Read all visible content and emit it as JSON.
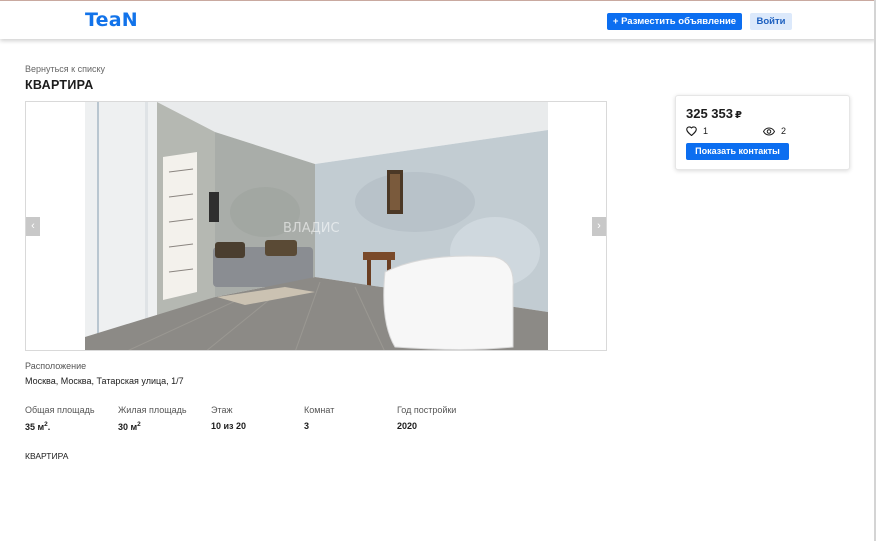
{
  "header": {
    "logo": "TeaN",
    "post_button": "+ Разместить объявление",
    "login_button": "Войти"
  },
  "breadcrumb": {
    "back": "Вернуться к списку"
  },
  "listing": {
    "title": "КВАРТИРА",
    "price": "325 353",
    "currency": "₽",
    "likes": "1",
    "views": "2",
    "contacts_button": "Показать контакты",
    "location_label": "Расположение",
    "location_value": "Москва, Москва, Татарская улица, 1/7",
    "specs": [
      {
        "label": "Общая площадь",
        "value": "35 м",
        "suffix": "."
      },
      {
        "label": "Жилая площадь",
        "value": "30 м",
        "suffix": ""
      },
      {
        "label": "Этаж",
        "value": "10 из 20"
      },
      {
        "label": "Комнат",
        "value": "3"
      },
      {
        "label": "Год постройки",
        "value": "2020"
      }
    ],
    "area_unit_power": "2",
    "description": "КВАРТИРА",
    "photo_watermark": "ВЛАДИС"
  },
  "icons": {
    "like": "heart-icon",
    "views": "eye-icon",
    "prev": "chevron-left-icon",
    "next": "chevron-right-icon"
  },
  "colors": {
    "brand": "#1273ea",
    "primary_button": "#0c6ef0",
    "secondary_button": "#dce9fb"
  }
}
